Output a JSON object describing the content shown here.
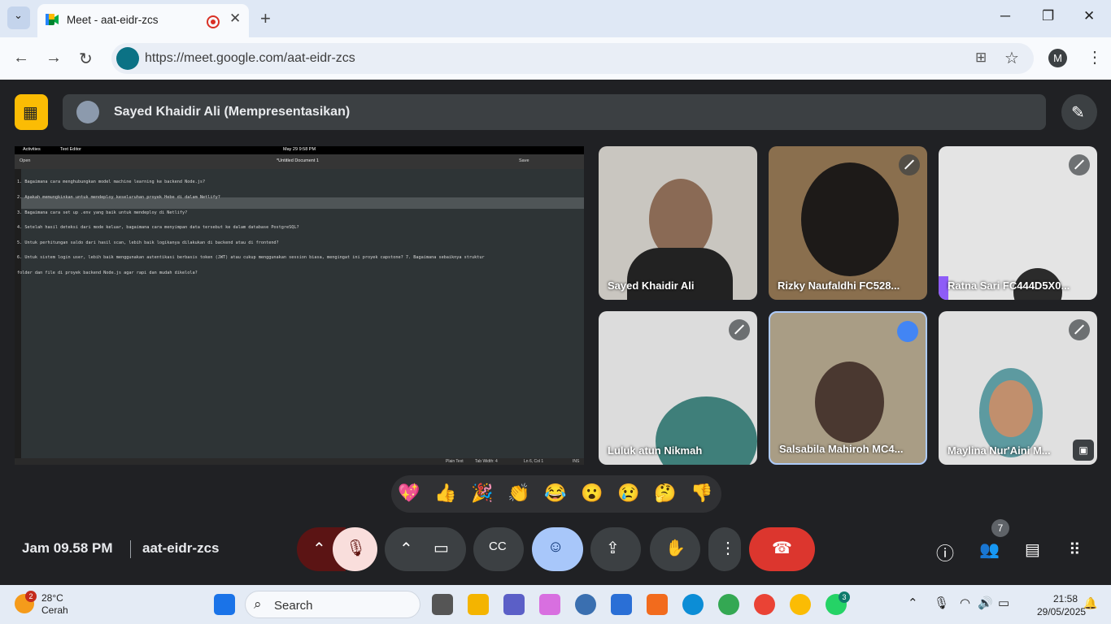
{
  "browser": {
    "tab_title": "Meet - aat-eidr-zcs",
    "url": "https://meet.google.com/aat-eidr-zcs",
    "profile_initial": "M"
  },
  "meet": {
    "presenting_label": "Sayed Khaidir Ali (Mempresentasikan)",
    "clock_label": "Jam 09.58 PM",
    "meeting_code": "aat-eidr-zcs",
    "participant_count": "7",
    "participants": [
      {
        "name": "Sayed Khaidir Ali"
      },
      {
        "name": "Rizky Naufaldhi FC528..."
      },
      {
        "name": "Ratna Sari FC444D5X0..."
      },
      {
        "name": "Luluk atun Nikmah"
      },
      {
        "name": "Salsabila Mahiroh MC4..."
      },
      {
        "name": "Maylina Nur'Aini M..."
      }
    ],
    "reactions": [
      "💖",
      "👍",
      "🎉",
      "👏",
      "😂",
      "😮",
      "😢",
      "🤔",
      "👎"
    ]
  },
  "shared_screen": {
    "topbar_left": "Activities",
    "topbar_app": "Text Editor",
    "topbar_date": "May 29  9:58 PM",
    "doc_title": "*Untitled Document 1",
    "open_label": "Open",
    "save_label": "Save",
    "lines": [
      "1. Bagaimana cara menghubungkan model machine learning ke backend Node.js?",
      "2. Apakah memungkinkan untuk mendeploy keseluruhan proyek Hebe di dalam Netlify?",
      "3. Bagaimana cara set up .env yang baik untuk mendeploy di Netlify?",
      "4. Setelah hasil deteksi dari mode keluar, bagaimana cara menyimpan data tersebut ke dalam database PostgreSQL?",
      "5. Untuk perhitungan saldo dari hasil scan, lebih baik logikanya dilakukan di backend atau di frontend?",
      "6. Untuk sistem login user, lebih baik menggunakan autentikasi berbasis token (JWT) atau cukup menggunakan session biasa, mengingat ini proyek capstone? 7. Bagaimana sebaiknya struktur",
      "folder dan file di proyek backend Node.js agar rapi dan mudah dikelola?"
    ],
    "status_items": [
      "Plain Text",
      "Tab Width: 4",
      "Ln 6, Col 1",
      "INS"
    ]
  },
  "taskbar": {
    "weather_temp": "28°C",
    "weather_desc": "Cerah",
    "weather_badge": "2",
    "search_placeholder": "Search",
    "time": "21:58",
    "date": "29/05/2025",
    "whatsapp_badge": "3"
  }
}
